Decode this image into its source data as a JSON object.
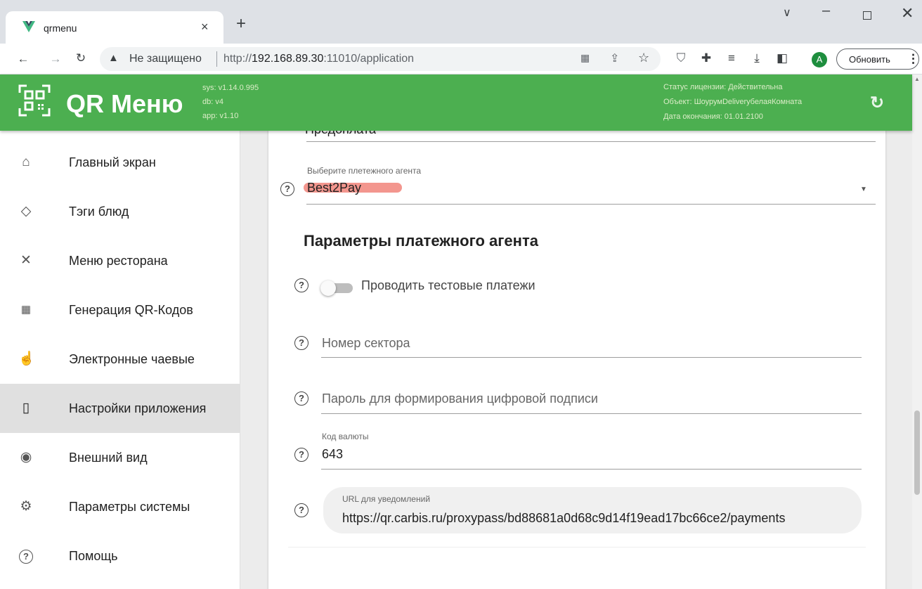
{
  "browser": {
    "tab_title": "qrmenu",
    "new_tab": "+",
    "address_security": "Не защищено",
    "address_url_prefix": "http://",
    "address_url_host": "192.168.89.30",
    "address_url_rest": ":11010/application",
    "update_button": "Обновить",
    "profile_letter": "A"
  },
  "header": {
    "logo_title": "QR Меню",
    "sys_version": "sys: v1.14.0.995",
    "db_version": "db: v4",
    "app_version": "app: v1.10",
    "license_status": "Статус лицензии: Действительна",
    "license_object": "Объект: ШоурумDeliveryбелаяКомната",
    "license_expiry": "Дата окончания: 01.01.2100"
  },
  "sidebar": {
    "items": [
      {
        "label": "Главный экран",
        "icon": "home-icon"
      },
      {
        "label": "Тэги блюд",
        "icon": "tag-icon"
      },
      {
        "label": "Меню ресторана",
        "icon": "utensils-icon"
      },
      {
        "label": "Генерация QR-Кодов",
        "icon": "qr-icon"
      },
      {
        "label": "Электронные чаевые",
        "icon": "hand-coin-icon"
      },
      {
        "label": "Настройки приложения",
        "icon": "app-settings-icon"
      },
      {
        "label": "Внешний вид",
        "icon": "eye-icon"
      },
      {
        "label": "Параметры системы",
        "icon": "gear-icon"
      },
      {
        "label": "Помощь",
        "icon": "help-icon"
      }
    ],
    "active_index": 5
  },
  "form": {
    "top_field_value": "Предоплата",
    "agent_label": "Выберите плетежного агента",
    "agent_value": "Best2Pay",
    "section_title": "Параметры платежного агента",
    "test_payments_label": "Проводить тестовые платежи",
    "test_payments_on": false,
    "sector_placeholder": "Номер сектора",
    "password_placeholder": "Пароль для формирования цифровой подписи",
    "currency_label": "Код валюты",
    "currency_value": "643",
    "url_label": "URL для уведомлений",
    "url_value": "https://qr.carbis.ru/proxypass/bd88681a0d68c9d14f19ead17bc66ce2/payments"
  },
  "colors": {
    "appbar": "#4caf50",
    "highlight": "#f28b82"
  }
}
